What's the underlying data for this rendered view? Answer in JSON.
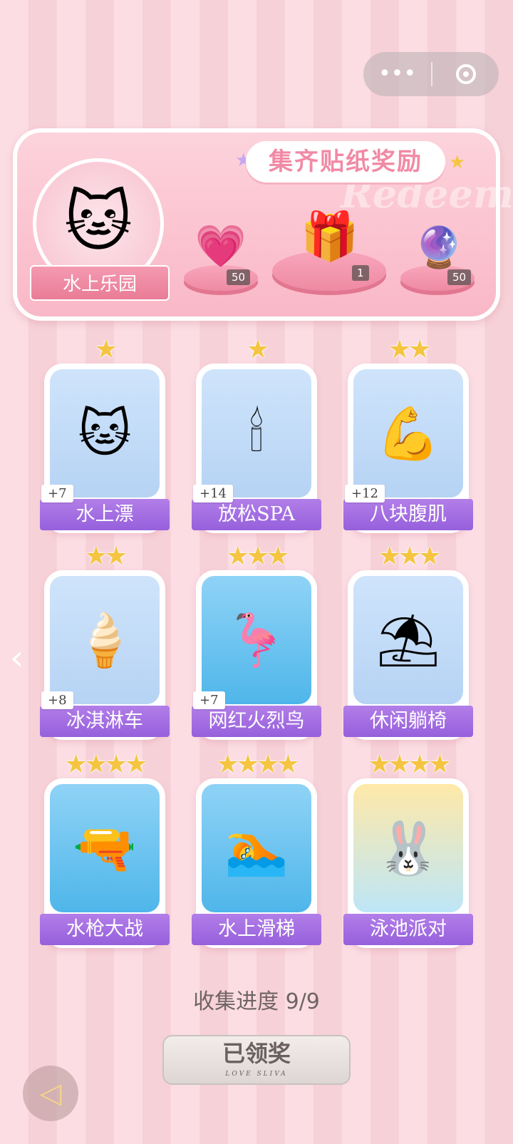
{
  "banner": {
    "title": "集齐贴纸奖励",
    "watermark": "Redeem",
    "theme_name": "水上乐园",
    "theme_icon": "🐱",
    "rewards": [
      {
        "icon": "heart-gem-icon",
        "glyph": "💗",
        "count": "50"
      },
      {
        "icon": "gift-box-icon",
        "glyph": "🎁",
        "count": "1"
      },
      {
        "icon": "lightning-orb-icon",
        "glyph": "🔮",
        "count": "50"
      }
    ]
  },
  "stickers": [
    {
      "name": "水上漂",
      "stars": "★",
      "plus": "+7",
      "glyph": "🐱",
      "bg": "blue"
    },
    {
      "name": "放松SPA",
      "stars": "★",
      "plus": "+14",
      "glyph": "🕯",
      "bg": "blue"
    },
    {
      "name": "八块腹肌",
      "stars": "★★",
      "plus": "+12",
      "glyph": "💪",
      "bg": "blue"
    },
    {
      "name": "冰淇淋车",
      "stars": "★★",
      "plus": "+8",
      "glyph": "🍦",
      "bg": "blue"
    },
    {
      "name": "网红火烈鸟",
      "stars": "★★★",
      "plus": "+7",
      "glyph": "🦩",
      "bg": "pool"
    },
    {
      "name": "休闲躺椅",
      "stars": "★★★",
      "plus": "",
      "glyph": "⛱",
      "bg": "blue"
    },
    {
      "name": "水枪大战",
      "stars": "★★★★",
      "plus": "",
      "glyph": "🔫",
      "bg": "pool"
    },
    {
      "name": "水上滑梯",
      "stars": "★★★★",
      "plus": "",
      "glyph": "🏊",
      "bg": "pool"
    },
    {
      "name": "泳池派对",
      "stars": "★★★★",
      "plus": "",
      "glyph": "🐰",
      "bg": "gold"
    }
  ],
  "progress": "收集进度  9/9",
  "claim_button": {
    "label": "已领奖",
    "sub": "LOVE SLIVA"
  },
  "nav": {
    "more": "•••",
    "left_arrow": "‹",
    "back": "◁"
  }
}
